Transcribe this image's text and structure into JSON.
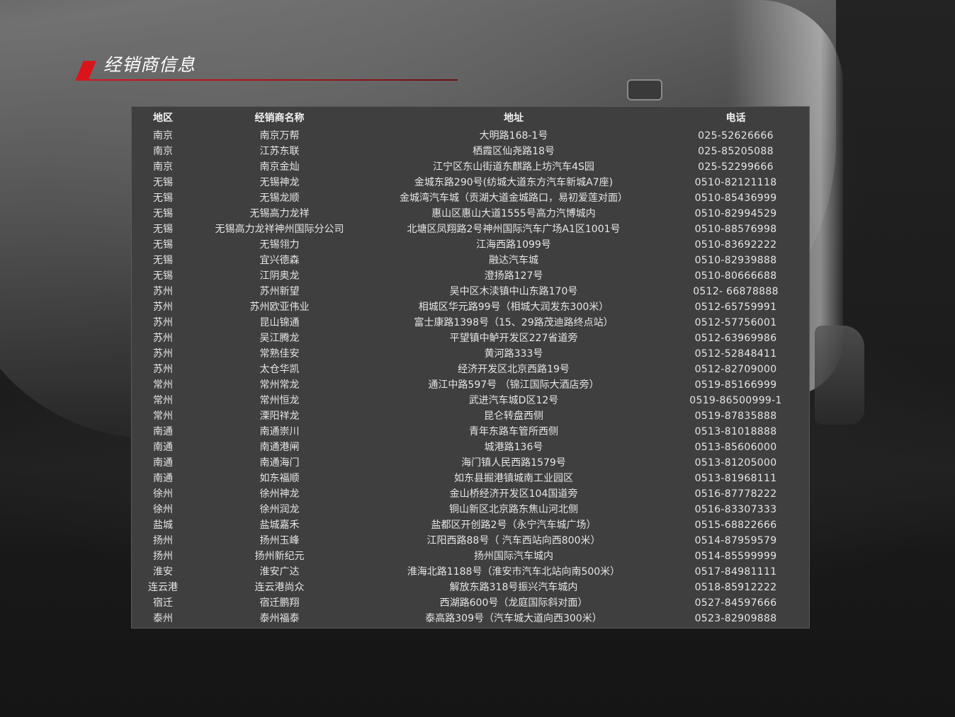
{
  "section": {
    "title": "经销商信息"
  },
  "colors": {
    "accent": "#d9141b",
    "panel_bg": "#3f3f3f",
    "text": "#e6e6e6"
  },
  "table": {
    "headers": {
      "region": "地区",
      "name": "经销商名称",
      "address": "地址",
      "phone": "电话"
    },
    "rows": [
      {
        "region": "南京",
        "name": "南京万帮",
        "address": "大明路168-1号",
        "phone": "025-52626666"
      },
      {
        "region": "南京",
        "name": "江苏东联",
        "address": "栖霞区仙尧路18号",
        "phone": "025-85205088"
      },
      {
        "region": "南京",
        "name": "南京金灿",
        "address": "江宁区东山街道东麒路上坊汽车4S园",
        "phone": "025-52299666"
      },
      {
        "region": "无锡",
        "name": "无锡神龙",
        "address": "金城东路290号(纺城大道东方汽车新城A7座)",
        "phone": "0510-82121118"
      },
      {
        "region": "无锡",
        "name": "无锡龙顺",
        "address": "金城湾汽车城（贡湖大道金城路口，易初爱莲对面）",
        "phone": "0510-85436999"
      },
      {
        "region": "无锡",
        "name": "无锡高力龙祥",
        "address": "惠山区惠山大道1555号高力汽博城内",
        "phone": "0510-82994529"
      },
      {
        "region": "无锡",
        "name": "无锡高力龙祥神州国际分公司",
        "address": "北塘区凤翔路2号神州国际汽车广场A1区1001号",
        "phone": "0510-88576998"
      },
      {
        "region": "无锡",
        "name": "无锡翎力",
        "address": "江海西路1099号",
        "phone": "0510-83692222"
      },
      {
        "region": "无锡",
        "name": "宜兴德森",
        "address": "融达汽车城",
        "phone": "0510-82939888"
      },
      {
        "region": "无锡",
        "name": "江阴奥龙",
        "address": "澄扬路127号",
        "phone": "0510-80666688"
      },
      {
        "region": "苏州",
        "name": "苏州新望",
        "address": "吴中区木渎镇中山东路170号",
        "phone": "0512- 66878888"
      },
      {
        "region": "苏州",
        "name": "苏州欧亚伟业",
        "address": "相城区华元路99号（相城大润发东300米）",
        "phone": "0512-65759991"
      },
      {
        "region": "苏州",
        "name": "昆山锦通",
        "address": "富士康路1398号（15、29路茂迪路终点站）",
        "phone": "0512-57756001"
      },
      {
        "region": "苏州",
        "name": "吴江腾龙",
        "address": "平望镇中鲈开发区227省道旁",
        "phone": "0512-63969986"
      },
      {
        "region": "苏州",
        "name": "常熟佳安",
        "address": "黄河路333号",
        "phone": "0512-52848411"
      },
      {
        "region": "苏州",
        "name": "太仓华凯",
        "address": "经济开发区北京西路19号",
        "phone": "0512-82709000"
      },
      {
        "region": "常州",
        "name": "常州常龙",
        "address": "通江中路597号 （锦江国际大酒店旁）",
        "phone": "0519-85166999"
      },
      {
        "region": "常州",
        "name": "常州恒龙",
        "address": "武进汽车城D区12号",
        "phone": "0519-86500999-1"
      },
      {
        "region": "常州",
        "name": "溧阳祥龙",
        "address": "昆仑转盘西侧",
        "phone": "0519-87835888"
      },
      {
        "region": "南通",
        "name": "南通崇川",
        "address": "青年东路车管所西侧",
        "phone": "0513-81018888"
      },
      {
        "region": "南通",
        "name": "南通港闸",
        "address": "城港路136号",
        "phone": "0513-85606000"
      },
      {
        "region": "南通",
        "name": "南通海门",
        "address": "海门镇人民西路1579号",
        "phone": "0513-81205000"
      },
      {
        "region": "南通",
        "name": "如东福顺",
        "address": "如东县掘港镇城南工业园区",
        "phone": "0513-81968111"
      },
      {
        "region": "徐州",
        "name": "徐州神龙",
        "address": "金山桥经济开发区104国道旁",
        "phone": "0516-87778222"
      },
      {
        "region": "徐州",
        "name": "徐州润龙",
        "address": "铜山新区北京路东焦山河北侧",
        "phone": "0516-83307333"
      },
      {
        "region": "盐城",
        "name": "盐城嘉禾",
        "address": "盐都区开创路2号（永宁汽车城广场）",
        "phone": "0515-68822666"
      },
      {
        "region": "扬州",
        "name": "扬州玉峰",
        "address": "江阳西路88号（ 汽车西站向西800米）",
        "phone": "0514-87959579"
      },
      {
        "region": "扬州",
        "name": "扬州新纪元",
        "address": "扬州国际汽车城内",
        "phone": "0514-85599999"
      },
      {
        "region": "淮安",
        "name": "淮安广达",
        "address": "淮海北路1188号（淮安市汽车北站向南500米）",
        "phone": "0517-84981111"
      },
      {
        "region": "连云港",
        "name": "连云港尚众",
        "address": "解放东路318号振兴汽车城内",
        "phone": "0518-85912222"
      },
      {
        "region": "宿迁",
        "name": "宿迁鹏翔",
        "address": "西湖路600号（龙庭国际斜对面）",
        "phone": "0527-84597666"
      },
      {
        "region": "泰州",
        "name": "泰州福泰",
        "address": "泰高路309号（汽车城大道向西300米）",
        "phone": "0523-82909888"
      }
    ]
  }
}
